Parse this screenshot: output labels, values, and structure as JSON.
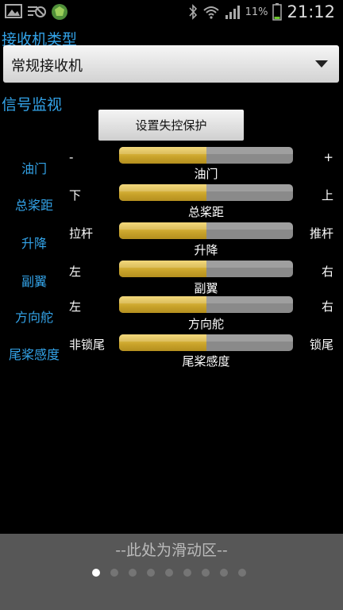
{
  "statusbar": {
    "battery_percent": "11%",
    "time": "21:12",
    "icons": [
      "image-icon",
      "blocked-notification-icon",
      "app-icon",
      "bluetooth-icon",
      "wifi-icon",
      "signal-icon",
      "battery-icon"
    ]
  },
  "receiver_section": {
    "title": "接收机类型",
    "selected": "常规接收机"
  },
  "monitor_section": {
    "title": "信号监视",
    "failsafe_button": "设置失控保护"
  },
  "channels": [
    {
      "label": "油门",
      "min": "-",
      "max": "+",
      "caption": "油门",
      "level": 0.5
    },
    {
      "label": "总桨距",
      "min": "下",
      "max": "上",
      "caption": "总桨距",
      "level": 0.5
    },
    {
      "label": "升降",
      "min": "拉杆",
      "max": "推杆",
      "caption": "升降",
      "level": 0.5
    },
    {
      "label": "副翼",
      "min": "左",
      "max": "右",
      "caption": "副翼",
      "level": 0.5
    },
    {
      "label": "方向舵",
      "min": "左",
      "max": "右",
      "caption": "方向舵",
      "level": 0.5
    },
    {
      "label": "尾桨感度",
      "min": "非锁尾",
      "max": "锁尾",
      "caption": "尾桨感度",
      "level": 0.5
    }
  ],
  "bottom": {
    "slide_text": "--此处为滑动区--",
    "page_count": 9,
    "active_page": 1
  },
  "colors": {
    "accent": "#33a3e8",
    "bar_fill": "#c9a32a",
    "bar_track": "#8a8a8a",
    "bottom_bg": "#575757"
  }
}
